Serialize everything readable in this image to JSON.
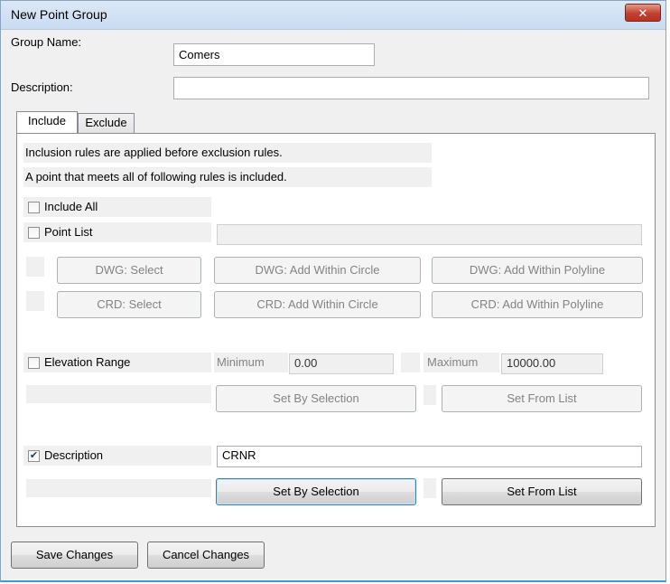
{
  "window": {
    "title": "New Point Group"
  },
  "icons": {
    "close": "close-icon"
  },
  "form": {
    "group_name_label": "Group Name:",
    "group_name_value": "Comers",
    "description_label": "Description:",
    "description_value": ""
  },
  "tabs": [
    {
      "label": "Include",
      "active": true
    },
    {
      "label": "Exclude",
      "active": false
    }
  ],
  "include": {
    "info_line1": "Inclusion rules are applied before exclusion rules.",
    "info_line2": "A point that meets all of following rules is included.",
    "include_all": {
      "label": "Include All",
      "checked": false
    },
    "point_list": {
      "label": "Point List",
      "checked": false,
      "value": ""
    },
    "dwg_buttons": [
      "DWG: Select",
      "DWG: Add Within Circle",
      "DWG: Add Within Polyline"
    ],
    "crd_buttons": [
      "CRD: Select",
      "CRD: Add Within Circle",
      "CRD: Add Within Polyline"
    ],
    "elevation": {
      "label": "Elevation Range",
      "checked": false,
      "min_label": "Minimum",
      "min_value": "0.00",
      "max_label": "Maximum",
      "max_value": "10000.00",
      "set_by_selection": "Set By Selection",
      "set_from_list": "Set From List"
    },
    "description_rule": {
      "label": "Description",
      "checked": true,
      "value": "CRNR",
      "set_by_selection": "Set By Selection",
      "set_from_list": "Set From List"
    }
  },
  "footer": {
    "save": "Save Changes",
    "cancel": "Cancel Changes"
  },
  "colors": {
    "title_bar": "#c9dcf1",
    "close_button": "#c24030",
    "panel_bg": "#f0f0f0"
  }
}
